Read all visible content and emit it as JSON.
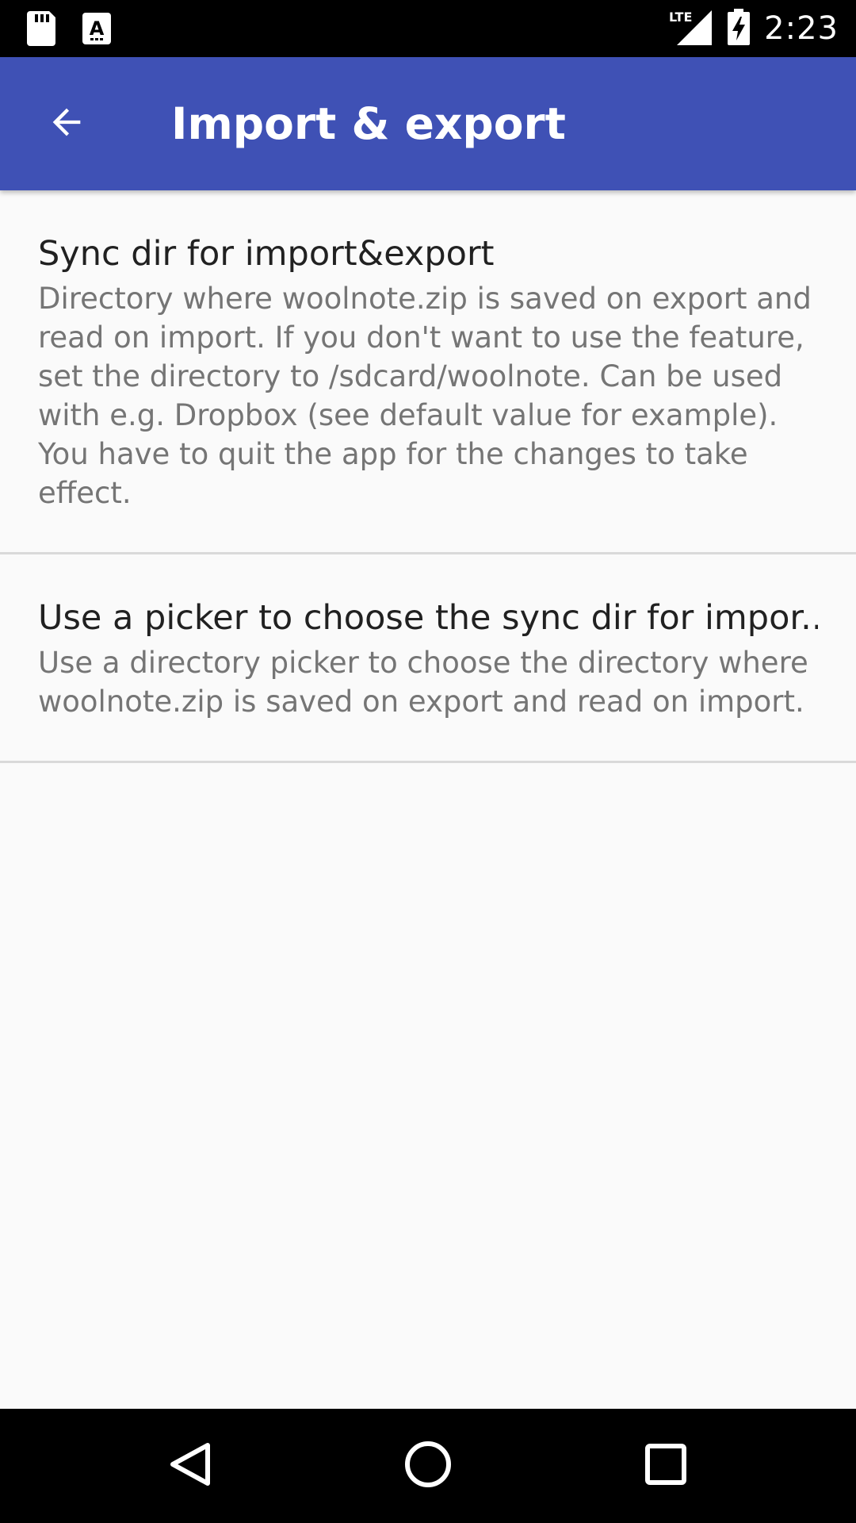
{
  "status_bar": {
    "time": "2:23",
    "network_label": "LTE",
    "icons": [
      "sd-card-icon",
      "keyboard-a-icon",
      "lte-signal-icon",
      "battery-charging-icon"
    ]
  },
  "app_bar": {
    "title": "Import & export",
    "back_icon": "arrow-back-icon",
    "color": "#3f51b5"
  },
  "preferences": [
    {
      "title": "Sync dir for import&export",
      "summary": "Directory where woolnote.zip is saved on export and read on import. If you don't want to use the feature, set the directory to /sdcard/woolnote. Can be used with e.g. Dropbox (see default value for example). You have to quit the app for the changes to take effect."
    },
    {
      "title": "Use a picker to choose the sync dir for impor..",
      "summary": "Use a directory picker to choose the directory where woolnote.zip is saved on export and read on import."
    }
  ],
  "nav_bar": {
    "icons": [
      "back-triangle-icon",
      "home-circle-icon",
      "recents-square-icon"
    ]
  }
}
